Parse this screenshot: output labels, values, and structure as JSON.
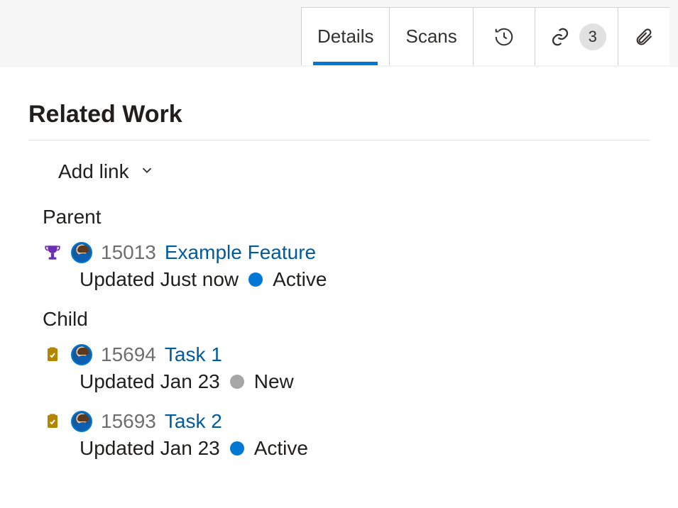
{
  "tabs": {
    "details": "Details",
    "scans": "Scans",
    "links_count": "3"
  },
  "section_title": "Related Work",
  "add_link_label": "Add link",
  "groups": {
    "parent": {
      "header": "Parent",
      "items": [
        {
          "type": "feature",
          "id": "15013",
          "title": "Example Feature",
          "updated": "Updated Just now",
          "state_label": "Active",
          "state_color": "blue"
        }
      ]
    },
    "child": {
      "header": "Child",
      "items": [
        {
          "type": "task",
          "id": "15694",
          "title": "Task 1",
          "updated": "Updated Jan 23",
          "state_label": "New",
          "state_color": "gray"
        },
        {
          "type": "task",
          "id": "15693",
          "title": "Task 2",
          "updated": "Updated Jan 23",
          "state_label": "Active",
          "state_color": "blue"
        }
      ]
    }
  }
}
